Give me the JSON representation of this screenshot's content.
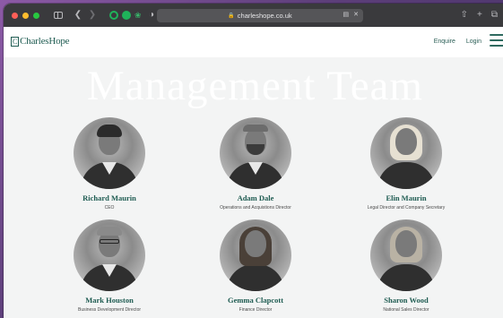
{
  "browser": {
    "url": "charleshope.co.uk",
    "icons": [
      "sidebar-icon",
      "back-icon",
      "forward-icon",
      "extension-icon",
      "shield-icon",
      "lock-icon",
      "reader-icon",
      "close-icon",
      "share-icon",
      "new-tab-icon",
      "tabs-icon"
    ]
  },
  "header": {
    "logo_text": "CharlesHope",
    "logo_mark": "C",
    "links": [
      {
        "label": "Enquire"
      },
      {
        "label": "Login"
      }
    ]
  },
  "main": {
    "title": "Management Team",
    "members": [
      {
        "name": "Richard Maurin",
        "role": "CEO"
      },
      {
        "name": "Adam Dale",
        "role": "Operations and Acquistions Director"
      },
      {
        "name": "Elin Maurin",
        "role": "Legal Director and Company Secretary"
      },
      {
        "name": "Mark Houston",
        "role": "Business Development Director"
      },
      {
        "name": "Gemma Clapcott",
        "role": "Finance Director"
      },
      {
        "name": "Sharon Wood",
        "role": "National Sales Director"
      }
    ]
  },
  "colors": {
    "brand": "#1f5c52",
    "toolbar": "#3a3a3d",
    "page_bg": "#f3f4f4"
  }
}
